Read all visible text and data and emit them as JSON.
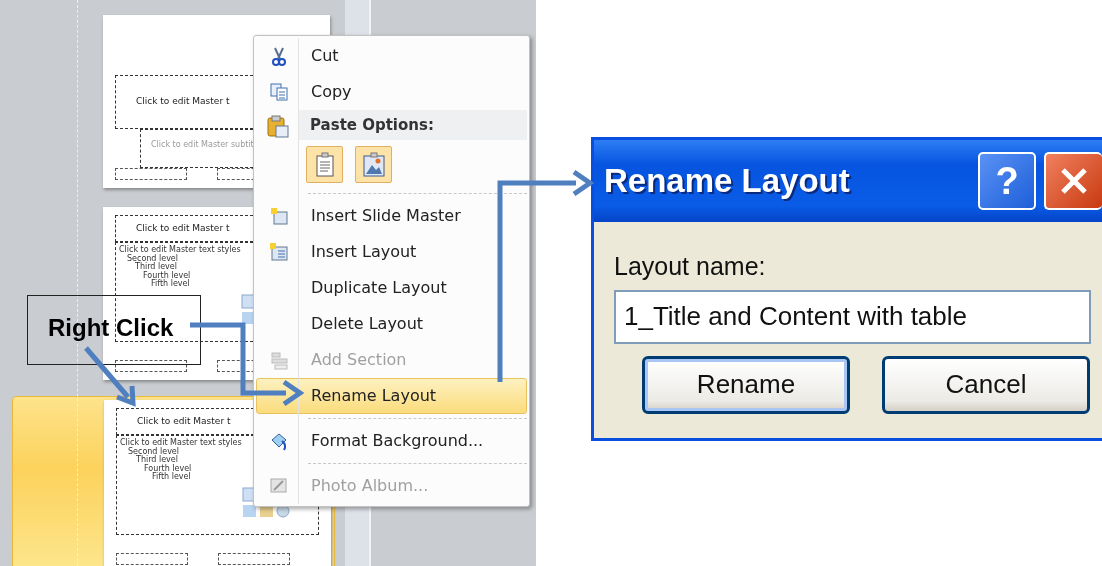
{
  "slide_panel": {
    "thumbnails": [
      {
        "kind": "title",
        "selected": false,
        "title": "Click to edit Master t",
        "subtitle": "Click to edit Master subtit"
      },
      {
        "kind": "content",
        "selected": false,
        "title": "Click to edit Master t",
        "levels": [
          "Click to edit Master text styles",
          "Second level",
          "Third level",
          "Fourth level",
          "Fifth level"
        ]
      },
      {
        "kind": "content",
        "selected": true,
        "title": "Click to edit Master t",
        "levels": [
          "Click to edit Master text styles",
          "Second level",
          "Third level",
          "Fourth level",
          "Fifth level"
        ]
      }
    ]
  },
  "context_menu": {
    "items": [
      {
        "kind": "item",
        "label": "Cut",
        "disabled": false,
        "selected": false
      },
      {
        "kind": "item",
        "label": "Copy",
        "disabled": false,
        "selected": false
      },
      {
        "kind": "header",
        "label": "Paste Options:"
      },
      {
        "kind": "paste_options",
        "options": [
          {
            "kind": "text"
          },
          {
            "kind": "picture"
          }
        ]
      },
      {
        "kind": "separator"
      },
      {
        "kind": "item",
        "label": "Insert Slide Master",
        "disabled": false,
        "selected": false
      },
      {
        "kind": "item",
        "label": "Insert Layout",
        "disabled": false,
        "selected": false
      },
      {
        "kind": "item",
        "label": "Duplicate Layout",
        "disabled": false,
        "selected": false
      },
      {
        "kind": "item",
        "label": "Delete Layout",
        "disabled": false,
        "selected": false
      },
      {
        "kind": "item",
        "label": "Add Section",
        "disabled": true,
        "selected": false
      },
      {
        "kind": "item",
        "label": "Rename Layout",
        "disabled": false,
        "selected": true
      },
      {
        "kind": "separator"
      },
      {
        "kind": "item",
        "label": "Format Background...",
        "disabled": false,
        "selected": false
      },
      {
        "kind": "separator"
      },
      {
        "kind": "item",
        "label": "Photo Album...",
        "disabled": true,
        "selected": false
      }
    ]
  },
  "callout": {
    "text": "Right Click"
  },
  "dialog": {
    "title": "Rename Layout",
    "help": "?",
    "field_label": "Layout name:",
    "field_value": "1_Title and Content with table",
    "buttons": [
      {
        "label": "Rename",
        "default": true
      },
      {
        "label": "Cancel",
        "default": false
      }
    ]
  }
}
